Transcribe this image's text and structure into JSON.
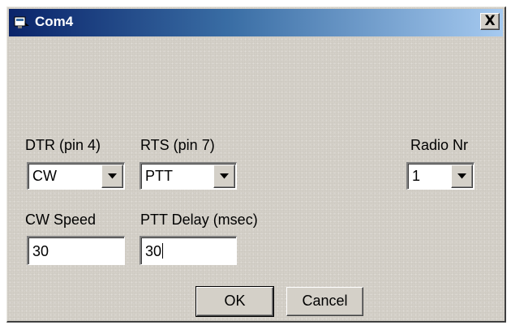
{
  "window": {
    "title": "Com4",
    "close_glyph": "X"
  },
  "fields": {
    "dtr_label": "DTR (pin 4)",
    "dtr_value": "CW",
    "rts_label": "RTS (pin 7)",
    "rts_value": "PTT",
    "radio_label": "Radio Nr",
    "radio_value": "1",
    "cw_speed_label": "CW Speed",
    "cw_speed_value": "30",
    "ptt_delay_label": "PTT Delay  (msec)",
    "ptt_delay_value": "30"
  },
  "buttons": {
    "ok_label": "OK",
    "cancel_label": "Cancel"
  },
  "icons": {
    "window_icon": "serial-port-icon",
    "dropdown_icon": "chevron-down-icon",
    "close_icon": "close-icon"
  },
  "colors": {
    "titlebar_start": "#0a246a",
    "titlebar_end": "#a6caf0",
    "face": "#d4d0c8"
  }
}
